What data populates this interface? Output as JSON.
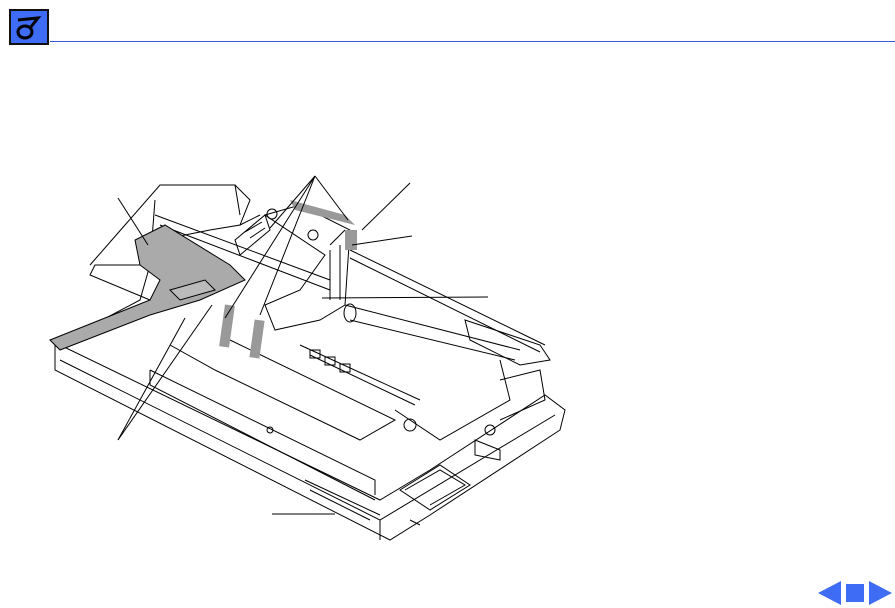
{
  "header": {
    "logo_icon": "apple-service-logo-icon",
    "rule_color": "#3a5ad8"
  },
  "illustration": {
    "subject": "printer-mechanism-exploded-view",
    "callout_count": 7
  },
  "navigation": {
    "accent_color": "#3f6cf5",
    "buttons": [
      {
        "icon": "previous-arrow-icon"
      },
      {
        "icon": "stop-square-icon"
      },
      {
        "icon": "next-arrow-icon"
      }
    ]
  }
}
